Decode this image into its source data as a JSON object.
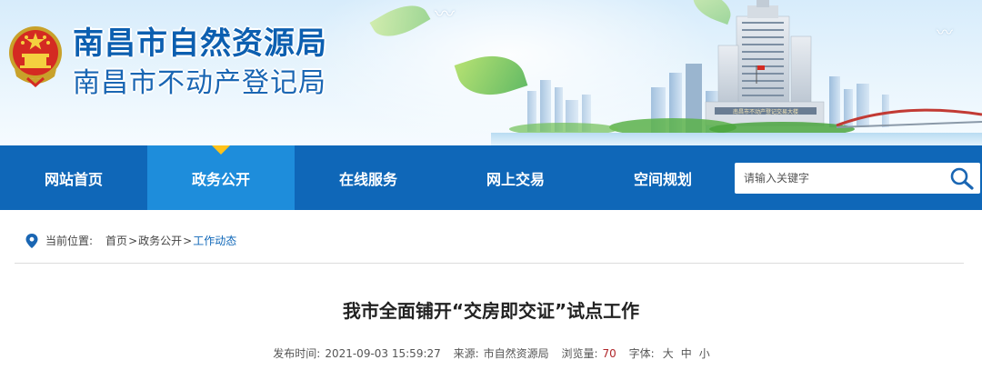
{
  "header": {
    "title_main": "南昌市自然资源局",
    "title_sub": "南昌市不动产登记局",
    "building_sign": "南昌市不动产登记交易大楼"
  },
  "nav": {
    "items": [
      {
        "label": "网站首页",
        "active": false
      },
      {
        "label": "政务公开",
        "active": true
      },
      {
        "label": "在线服务",
        "active": false
      },
      {
        "label": "网上交易",
        "active": false
      },
      {
        "label": "空间规划",
        "active": false
      }
    ],
    "search": {
      "placeholder": "请输入关键字",
      "icon": "search-icon"
    }
  },
  "breadcrumb": {
    "label": "当前位置:",
    "items": [
      "首页",
      "政务公开",
      "工作动态"
    ],
    "separator": ">"
  },
  "article": {
    "title": "我市全面铺开“交房即交证”试点工作",
    "publish_label": "发布时间:",
    "publish_time": "2021-09-03 15:59:27",
    "source_label": "来源:",
    "source": "市自然资源局",
    "views_label": "浏览量:",
    "views": "70",
    "fontsize_label": "字体:",
    "fontsize_options": [
      "大",
      "中",
      "小"
    ]
  },
  "colors": {
    "nav_bg": "#0f67b8",
    "nav_active": "#1e8ddb",
    "nav_marker": "#ffc21a",
    "title_blue": "#0c5fb0",
    "views_red": "#b0262a"
  }
}
